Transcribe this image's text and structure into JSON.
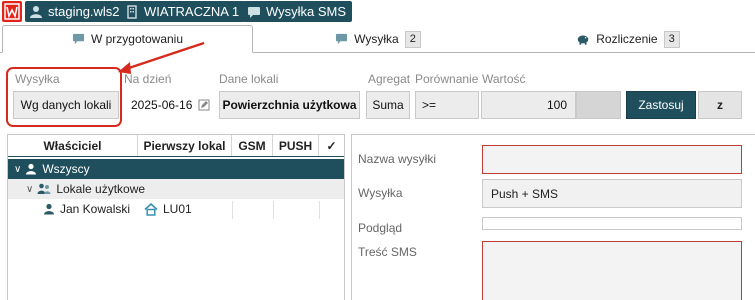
{
  "topbar": {
    "chips": [
      {
        "label": "staging.wls2",
        "icon": "user-icon"
      },
      {
        "label": "WIATRACZNA 1",
        "icon": "building-icon"
      },
      {
        "label": "Wysyłka SMS",
        "icon": "message-icon"
      }
    ]
  },
  "tabs": [
    {
      "label": "W przygotowaniu",
      "icon": "message-icon",
      "active": true
    },
    {
      "label": "Wysyłka",
      "icon": "message-icon",
      "badge": "2"
    },
    {
      "label": "Rozliczenie",
      "icon": "piggy-bank-icon",
      "badge": "3"
    }
  ],
  "filters": {
    "wysylka": {
      "label": "Wysyłka",
      "value": "Wg danych lokali"
    },
    "na_dzien": {
      "label": "Na dzień",
      "value": "2025-06-16"
    },
    "dane_lokali": {
      "label": "Dane lokali",
      "value": "Powierzchnia użytkowa"
    },
    "agregat": {
      "label": "Agregat",
      "value": "Suma"
    },
    "porownanie": {
      "label": "Porównanie",
      "value": ">="
    },
    "wartosc": {
      "label": "Wartość",
      "value": "100"
    },
    "apply_label": "Zastosuj",
    "z_label": "z"
  },
  "tree": {
    "columns": [
      "Właściciel",
      "Pierwszy lokal",
      "GSM",
      "PUSH",
      "✓"
    ],
    "rows": [
      {
        "label": "Wszyscy",
        "level": 0,
        "selected": true
      },
      {
        "label": "Lokale użytkowe",
        "level": 1
      },
      {
        "label": "Jan Kowalski",
        "level": 2,
        "first_unit": "LU01"
      }
    ]
  },
  "details": {
    "fields": [
      {
        "label": "Nazwa wysyłki",
        "value": ""
      },
      {
        "label": "Wysyłka",
        "value": "Push + SMS"
      },
      {
        "label": "Podgląd",
        "value": ""
      },
      {
        "label": "Treść SMS",
        "value": ""
      }
    ]
  },
  "colors": {
    "accent": "#1f4f5c",
    "brand": "#e2231a",
    "highlight": "#d62a1e",
    "error_border": "#c23a35"
  }
}
